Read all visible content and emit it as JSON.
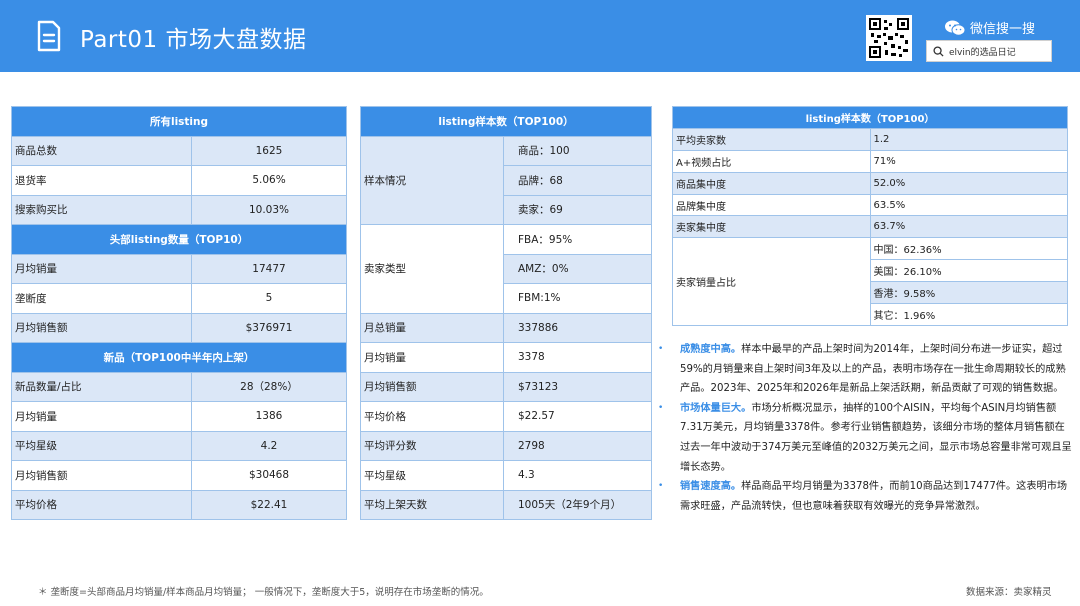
{
  "header": {
    "title": "Part01 市场大盘数据",
    "wechat_label": "微信搜一搜",
    "search_text": "elvin的选品日记",
    "bg_color": "#3a8ee6"
  },
  "table1": {
    "sections": [
      {
        "heading": "所有listing",
        "rows": [
          {
            "label": "商品总数",
            "value": "1625"
          },
          {
            "label": "退货率",
            "value": "5.06%"
          },
          {
            "label": "搜索购买比",
            "value": "10.03%"
          }
        ]
      },
      {
        "heading": "头部listing数量（TOP10）",
        "rows": [
          {
            "label": "月均销量",
            "value": "17477"
          },
          {
            "label": "垄断度",
            "value": "5"
          },
          {
            "label": "月均销售额",
            "value": "$376971"
          }
        ]
      },
      {
        "heading": "新品（TOP100中半年内上架）",
        "rows": [
          {
            "label": "新品数量/占比",
            "value": "28（28%）"
          },
          {
            "label": "月均销量",
            "value": "1386"
          },
          {
            "label": "平均星级",
            "value": "4.2"
          },
          {
            "label": "月均销售额",
            "value": "$30468"
          },
          {
            "label": "平均价格",
            "value": "$22.41"
          }
        ]
      }
    ]
  },
  "table2": {
    "heading": "listing样本数（TOP100）",
    "groups": [
      {
        "label": "样本情况",
        "values": [
          "商品：100",
          "品牌：68",
          "卖家：69"
        ]
      },
      {
        "label": "卖家类型",
        "values": [
          "FBA：95%",
          "AMZ：0%",
          "FBM:1%"
        ]
      }
    ],
    "rows": [
      {
        "label": "月总销量",
        "value": "337886"
      },
      {
        "label": "月均销量",
        "value": "3378"
      },
      {
        "label": "月均销售额",
        "value": "$73123"
      },
      {
        "label": "平均价格",
        "value": "$22.57"
      },
      {
        "label": "平均评分数",
        "value": "2798"
      },
      {
        "label": "平均星级",
        "value": "4.3"
      },
      {
        "label": "平均上架天数",
        "value": "1005天（2年9个月）"
      }
    ]
  },
  "table3": {
    "heading": "listing样本数（TOP100）",
    "rows": [
      {
        "label": "平均卖家数",
        "value": "1.2"
      },
      {
        "label": "A+视频占比",
        "value": "71%"
      },
      {
        "label": "商品集中度",
        "value": "52.0%"
      },
      {
        "label": "品牌集中度",
        "value": "63.5%"
      },
      {
        "label": "卖家集中度",
        "value": "63.7%"
      }
    ],
    "group": {
      "label": "卖家销量占比",
      "values": [
        "中国：62.36%",
        "美国：26.10%",
        "香港：9.58%",
        "其它：1.96%"
      ]
    }
  },
  "notes": [
    {
      "title": "成熟度中高。",
      "text": "样本中最早的产品上架时间为2014年，上架时间分布进一步证实，超过59%的月销量来自上架时间3年及以上的产品，表明市场存在一批生命周期较长的成熟产品。2023年、2025年和2026年是新品上架活跃期，新品贡献了可观的销售数据。"
    },
    {
      "title": "市场体量巨大。",
      "text": "市场分析概况显示，抽样的100个AISIN，平均每个ASIN月均销售额7.31万美元，月均销量3378件。参考行业销售额趋势，该细分市场的整体月销售额在过去一年中波动于374万美元至峰值的2032万美元之间，显示市场总容量非常可观且呈增长态势。"
    },
    {
      "title": "销售速度高。",
      "text": "样品商品平均月销量为3378件，而前10商品达到17477件。这表明市场需求旺盛，产品流转快，但也意味着获取有效曝光的竞争异常激烈。"
    }
  ],
  "footnote": "＊ 垄断度=头部商品月均销量/样本商品月均销量；  一般情况下，垄断度大于5，说明存在市场垄断的情况。",
  "source": "数据来源：卖家精灵"
}
